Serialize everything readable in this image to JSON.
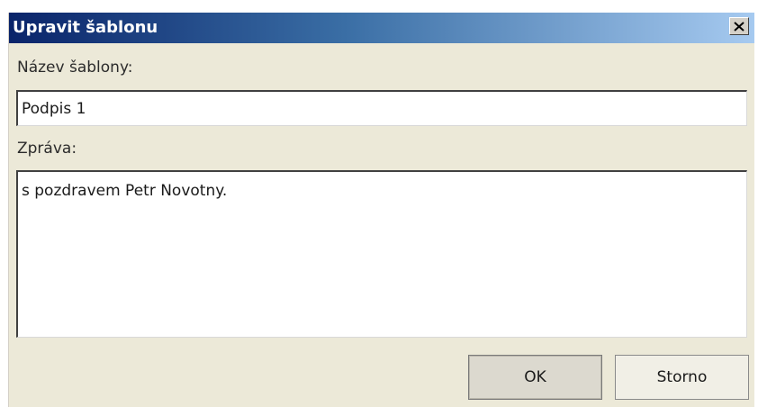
{
  "dialog": {
    "title": "Upravit šablonu",
    "close_icon": "close-icon"
  },
  "form": {
    "name_label": "Název šablony:",
    "name_value": "Podpis 1",
    "message_label": "Zpráva:",
    "message_value": "s pozdravem Petr Novotny."
  },
  "buttons": {
    "ok_label": "OK",
    "cancel_label": "Storno"
  },
  "colors": {
    "title_gradient_start": "#0a246a",
    "title_gradient_end": "#a6caf0",
    "dialog_bg": "#ece9d8"
  }
}
